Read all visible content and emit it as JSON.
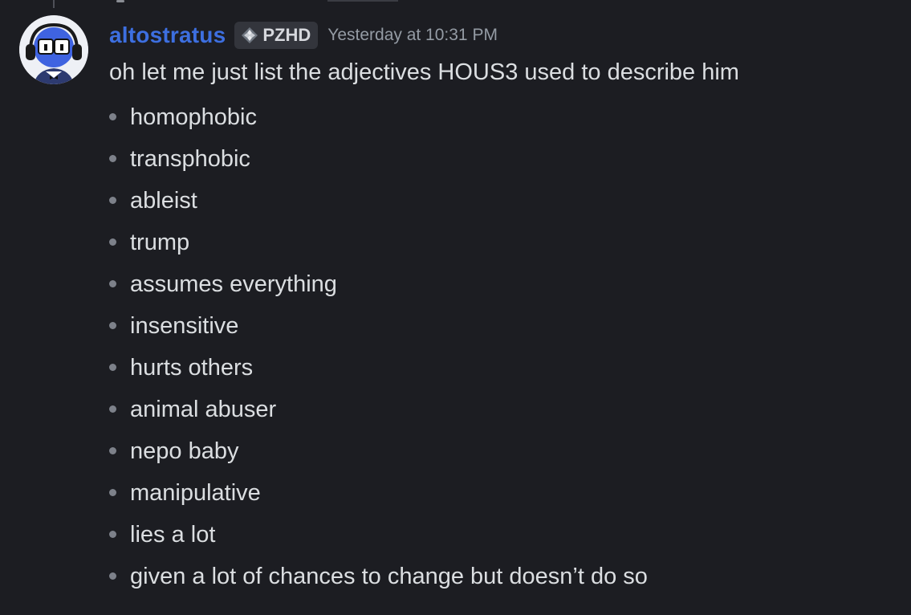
{
  "message": {
    "username": "altostratus",
    "tag": {
      "label": "PZHD",
      "icon": "diamond-badge-icon"
    },
    "timestamp": "Yesterday at 10:31 PM",
    "text": "oh let me just list the adjectives HOUS3 used to describe him",
    "list_items": [
      "homophobic",
      "transphobic",
      "ableist",
      "trump",
      "assumes everything",
      "insensitive",
      "hurts others",
      "animal abuser",
      "nepo baby",
      "manipulative",
      "lies a lot",
      "given a lot of chances to change but doesn’t do so"
    ]
  },
  "colors": {
    "background": "#1c1d22",
    "username": "#3d6fe0",
    "text": "#dbdee1",
    "timestamp": "#949ba4",
    "tag_background": "#33353c",
    "bullet": "#7d818a"
  }
}
